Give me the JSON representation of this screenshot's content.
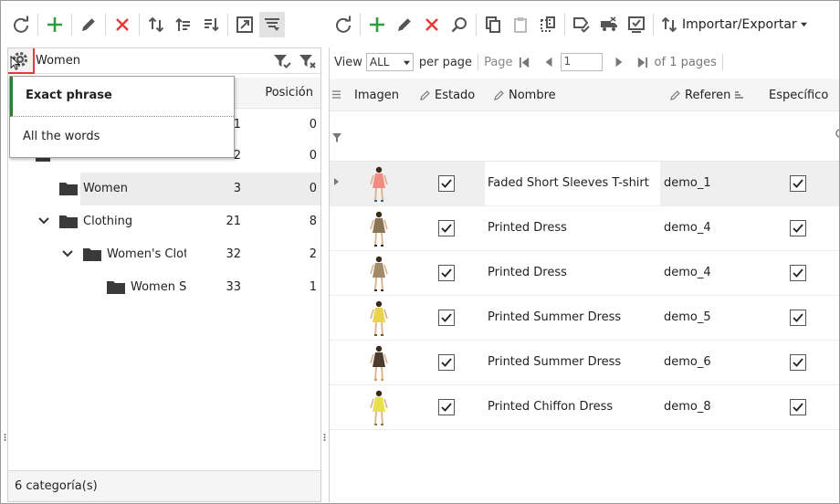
{
  "search": {
    "value": "Women"
  },
  "dropdown": {
    "items": [
      "Exact phrase",
      "All the words"
    ]
  },
  "left_header": {
    "position_label": "Posición"
  },
  "tree": [
    {
      "label": "",
      "count": "1",
      "position": "0"
    },
    {
      "label": "",
      "count": "2",
      "position": "0"
    },
    {
      "label": "Women",
      "count": "3",
      "position": "0"
    },
    {
      "label": "Clothing",
      "count": "21",
      "position": "8"
    },
    {
      "label": "Women's Clothing",
      "count": "32",
      "position": "2"
    },
    {
      "label": "Women Sweaters",
      "count": "33",
      "position": "1"
    }
  ],
  "left_footer": "6 categoría(s)",
  "right_toolbar": {
    "import_export_label": "Importar/Exportar"
  },
  "pager": {
    "view_label": "View",
    "view_value": "ALL",
    "per_page_label": "per page",
    "page_label": "Page",
    "page_value": "1",
    "total_label": "of 1 pages"
  },
  "columns": [
    "Imagen",
    "Estado",
    "Nombre",
    "Referen",
    "Específico"
  ],
  "products": [
    {
      "name": "Faded Short Sleeves T-shirt",
      "ref": "demo_1",
      "status": true,
      "specific": true,
      "colors": [
        "#f28b82",
        "#3b5d8a"
      ]
    },
    {
      "name": "Printed Dress",
      "ref": "demo_4",
      "status": true,
      "specific": true,
      "colors": [
        "#8b7355",
        "#3a2a1a"
      ]
    },
    {
      "name": "Printed Dress",
      "ref": "demo_4",
      "status": true,
      "specific": true,
      "colors": [
        "#a08a6a",
        "#3a2a1a"
      ]
    },
    {
      "name": "Printed Summer Dress",
      "ref": "demo_5",
      "status": true,
      "specific": true,
      "colors": [
        "#e8d44d",
        "#6d5a2e"
      ]
    },
    {
      "name": "Printed Summer Dress",
      "ref": "demo_6",
      "status": true,
      "specific": true,
      "colors": [
        "#4a3b2c",
        "#c9a24b"
      ]
    },
    {
      "name": "Printed Chiffon Dress",
      "ref": "demo_8",
      "status": true,
      "specific": true,
      "colors": [
        "#e8e04d",
        "#8a7a3a"
      ]
    }
  ],
  "colors": {
    "green": "#2e9e3e",
    "red": "#e53935",
    "grey_icon": "#555555",
    "highlight_border": "#e53935"
  }
}
